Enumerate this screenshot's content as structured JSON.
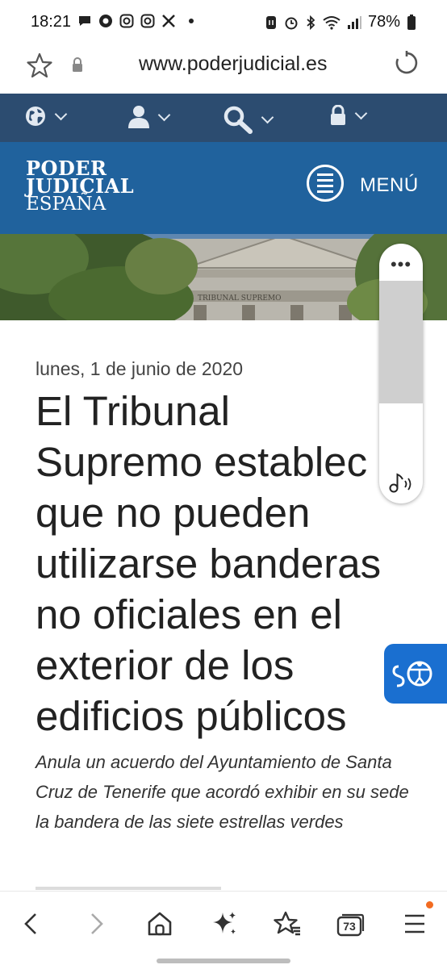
{
  "status_bar": {
    "time": "18:21",
    "battery": "78%",
    "left_icons": [
      "message-icon",
      "circle-app-icon",
      "instagram-icon",
      "instagram-icon",
      "x-icon"
    ],
    "right_icons": [
      "nfc-icon",
      "alarm-icon",
      "bluetooth-icon",
      "wifi-icon",
      "signal-icon",
      "battery-icon"
    ]
  },
  "browser": {
    "url": "www.poderjudicial.es"
  },
  "site": {
    "logo": {
      "line1": "PODER",
      "line2": "JUDICIAL",
      "line3": "ESPAÑA"
    },
    "menu_label": "MENÚ",
    "banner_inscription": "TRIBUNAL SUPREMO",
    "colors": {
      "toolbar": "#2c4c70",
      "header": "#20629d",
      "accessibility": "#1a6fd0"
    }
  },
  "article": {
    "date": "lunes, 1 de junio de 2020",
    "headline_lines": [
      "El Tribunal",
      "Supremo establec",
      "que no pueden",
      "utilizarse banderas",
      "no oficiales en el",
      "exterior de los",
      "edificios públicos"
    ],
    "subtitle": "Anula un acuerdo del Ayuntamiento de Santa Cruz de Tenerife que acordó exhibir en su sede la bandera de las siete estrellas verdes"
  },
  "media_panel": {
    "more": "•••"
  },
  "bottom_nav": {
    "tabs_count": "73",
    "icons": [
      "back-icon",
      "forward-icon",
      "home-icon",
      "sparkle-icon",
      "bookmarks-icon",
      "tabs-icon",
      "menu-icon"
    ]
  }
}
